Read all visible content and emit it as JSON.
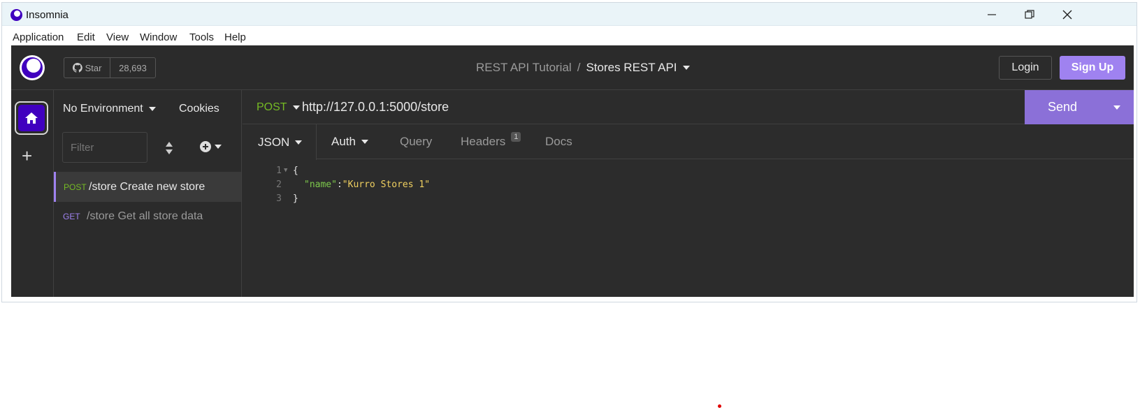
{
  "window": {
    "title": "Insomnia",
    "controls": [
      "minimize",
      "restore",
      "close"
    ]
  },
  "menubar": [
    "Application",
    "Edit",
    "View",
    "Window",
    "Tools",
    "Help"
  ],
  "topbar": {
    "star_label": "Star",
    "star_count": "28,693",
    "breadcrumb_project": "REST API Tutorial",
    "breadcrumb_sep": "/",
    "breadcrumb_current": "Stores REST API",
    "login_label": "Login",
    "signup_label": "Sign Up"
  },
  "sidebar": {
    "environment": "No Environment",
    "cookies": "Cookies",
    "filter_placeholder": "Filter",
    "requests": [
      {
        "method": "POST",
        "method_color": "#75ba24",
        "label": "/store Create new store",
        "active": true
      },
      {
        "method": "GET",
        "method_color": "#9f82f0",
        "label": "/store Get all store data",
        "active": false
      }
    ]
  },
  "request": {
    "method": "POST",
    "url": "http://127.0.0.1:5000/store",
    "send_label": "Send",
    "tabs": [
      {
        "label": "JSON",
        "active": true,
        "dropdown": true
      },
      {
        "label": "Auth",
        "dropdown": true
      },
      {
        "label": "Query"
      },
      {
        "label": "Headers",
        "badge": "1"
      },
      {
        "label": "Docs"
      }
    ],
    "body_lines": [
      {
        "num": "1",
        "text": "{"
      },
      {
        "num": "2",
        "key": "\"name\"",
        "sep": ":",
        "value": "\"Kurro Stores 1\""
      },
      {
        "num": "3",
        "text": "}"
      }
    ]
  },
  "colors": {
    "accent": "#9f82f0",
    "brand": "#4000bf",
    "post": "#75ba24",
    "background": "#2c2c2c"
  }
}
